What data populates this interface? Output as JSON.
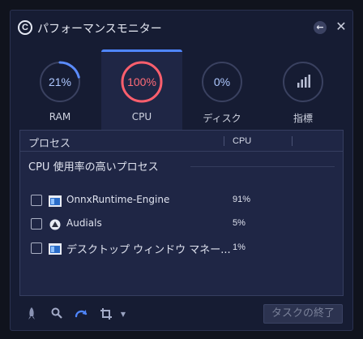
{
  "window": {
    "title": "パフォーマンスモニター",
    "logo_text": "C",
    "back_icon": "arrow-left-icon",
    "close_icon": "close-icon"
  },
  "metrics": [
    {
      "id": "ram",
      "value_text": "21%",
      "label": "RAM",
      "progress": 0.21,
      "ring_color": "#5b8cff",
      "text_color": "#aec8ff",
      "active": false
    },
    {
      "id": "cpu",
      "value_text": "100%",
      "label": "CPU",
      "progress": 1.0,
      "ring_color": "#ff5f6d",
      "text_color": "#ff6b77",
      "active": true
    },
    {
      "id": "disk",
      "value_text": "0%",
      "label": "ディスク",
      "progress": 0.0,
      "ring_color": "#5b8cff",
      "text_color": "#aec8ff",
      "active": false
    },
    {
      "id": "index",
      "value_text": "",
      "label": "指標",
      "icon": "bar-chart-icon",
      "progress": 0.0,
      "ring_color": "#5b8cff",
      "text_color": "#aec8ff",
      "active": false
    }
  ],
  "table": {
    "col_process": "プロセス",
    "col_cpu": "CPU",
    "group_title": "CPU 使用率の高いプロセス",
    "rows": [
      {
        "name": "OnnxRuntime-Engine",
        "cpu": "91%",
        "icon": "window-app-icon",
        "checked": false
      },
      {
        "name": "Audials",
        "cpu": "5%",
        "icon": "audials-icon",
        "checked": false
      },
      {
        "name": "デスクトップ ウィンドウ マネー...",
        "cpu": "1%",
        "icon": "window-app-icon",
        "checked": false
      }
    ]
  },
  "toolbar": {
    "tools": [
      "rocket-icon",
      "search-icon",
      "refresh-icon",
      "crop-icon",
      "dropdown-icon"
    ],
    "end_task_label": "タスクの終了"
  },
  "colors": {
    "accent": "#4f86ff",
    "cpu_alert": "#ff5f6d",
    "background": "#161c33"
  }
}
